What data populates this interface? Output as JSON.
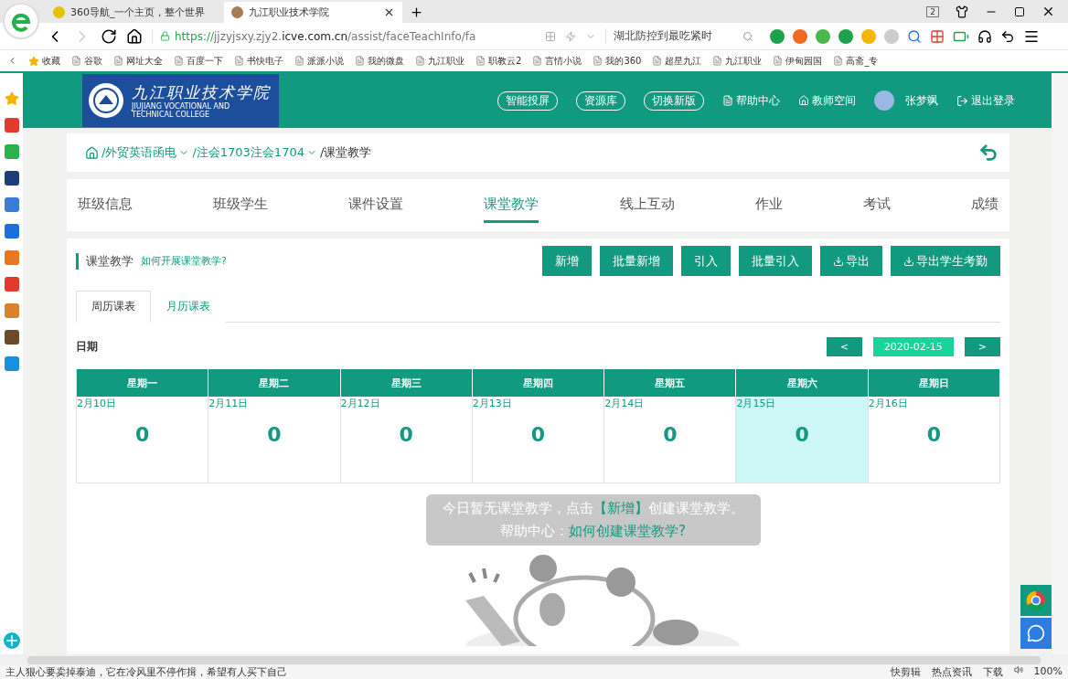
{
  "browser": {
    "tabs": [
      {
        "title": "360导航_一个主页，整个世界",
        "selected": false
      },
      {
        "title": "九江职业技术学院",
        "selected": true
      }
    ],
    "window_count": "2",
    "url": {
      "scheme": "https://",
      "host_prefix": "jjzyjsxy.zjy2.",
      "host_main": "icve.com.cn",
      "path": "/assist/faceTeachInfo/fa"
    },
    "search": {
      "value": "湖北防控到最吃紧时"
    },
    "bookmarks": [
      "收藏",
      "谷歌",
      "网址大全",
      "百度一下",
      "书快电子",
      "派派小说",
      "我的微盘",
      "九江职业",
      "职教云2",
      "言情小说",
      "我的360",
      "超星九江",
      "九江职业",
      "伊甸园国",
      "高斋_专"
    ]
  },
  "header": {
    "logo_title": "九江职业技术学院",
    "logo_subtitle": "JIUJIANG VOCATIONAL AND TECHNICAL COLLEGE",
    "pill_links": [
      "智能投屏",
      "资源库",
      "切换新版"
    ],
    "help": "帮助中心",
    "teacher_space": "教师空间",
    "user": "张梦飒",
    "logout": "退出登录"
  },
  "breadcrumb": {
    "course": "/外贸英语函电",
    "class": "/注会1703注会1704",
    "current": "/课堂教学"
  },
  "tabs": [
    {
      "label": "班级信息",
      "selected": false
    },
    {
      "label": "班级学生",
      "selected": false
    },
    {
      "label": "课件设置",
      "selected": false
    },
    {
      "label": "课堂教学",
      "selected": true
    },
    {
      "label": "线上互动",
      "selected": false
    },
    {
      "label": "作业",
      "selected": false
    },
    {
      "label": "考试",
      "selected": false
    },
    {
      "label": "成绩",
      "selected": false
    }
  ],
  "section": {
    "title": "课堂教学",
    "help_link": "如何开展课堂教学?",
    "buttons": [
      {
        "label": "新增",
        "icon": false
      },
      {
        "label": "批量新增",
        "icon": false
      },
      {
        "label": "引入",
        "icon": false
      },
      {
        "label": "批量引入",
        "icon": false
      },
      {
        "label": "导出",
        "icon": true
      },
      {
        "label": "导出学生考勤",
        "icon": true
      }
    ]
  },
  "subtabs": [
    {
      "label": "周历课表",
      "selected": true
    },
    {
      "label": "月历课表",
      "selected": false
    }
  ],
  "date_bar": {
    "label": "日期",
    "prev": "<",
    "date": "2020-02-15",
    "next": ">"
  },
  "week": [
    {
      "weekday": "星期一",
      "date": "2月10日",
      "count": "0",
      "selected": false
    },
    {
      "weekday": "星期二",
      "date": "2月11日",
      "count": "0",
      "selected": false
    },
    {
      "weekday": "星期三",
      "date": "2月12日",
      "count": "0",
      "selected": false
    },
    {
      "weekday": "星期四",
      "date": "2月13日",
      "count": "0",
      "selected": false
    },
    {
      "weekday": "星期五",
      "date": "2月14日",
      "count": "0",
      "selected": false
    },
    {
      "weekday": "星期六",
      "date": "2月15日",
      "count": "0",
      "selected": true
    },
    {
      "weekday": "星期日",
      "date": "2月16日",
      "count": "0",
      "selected": false
    }
  ],
  "empty_message": {
    "before": "今日暂无课堂教学，点击",
    "highlight": "【新增】",
    "after": "创建课堂教学。",
    "help_label": "帮助中心：",
    "help_link": "如何创建课堂教学?"
  },
  "status_bar": {
    "news": "主人狠心要卖掉泰迪，它在冷风里不停作揖，希望有人买下自己",
    "items": [
      "快剪辑",
      "热点资讯",
      "下载"
    ],
    "zoom": "100%"
  }
}
